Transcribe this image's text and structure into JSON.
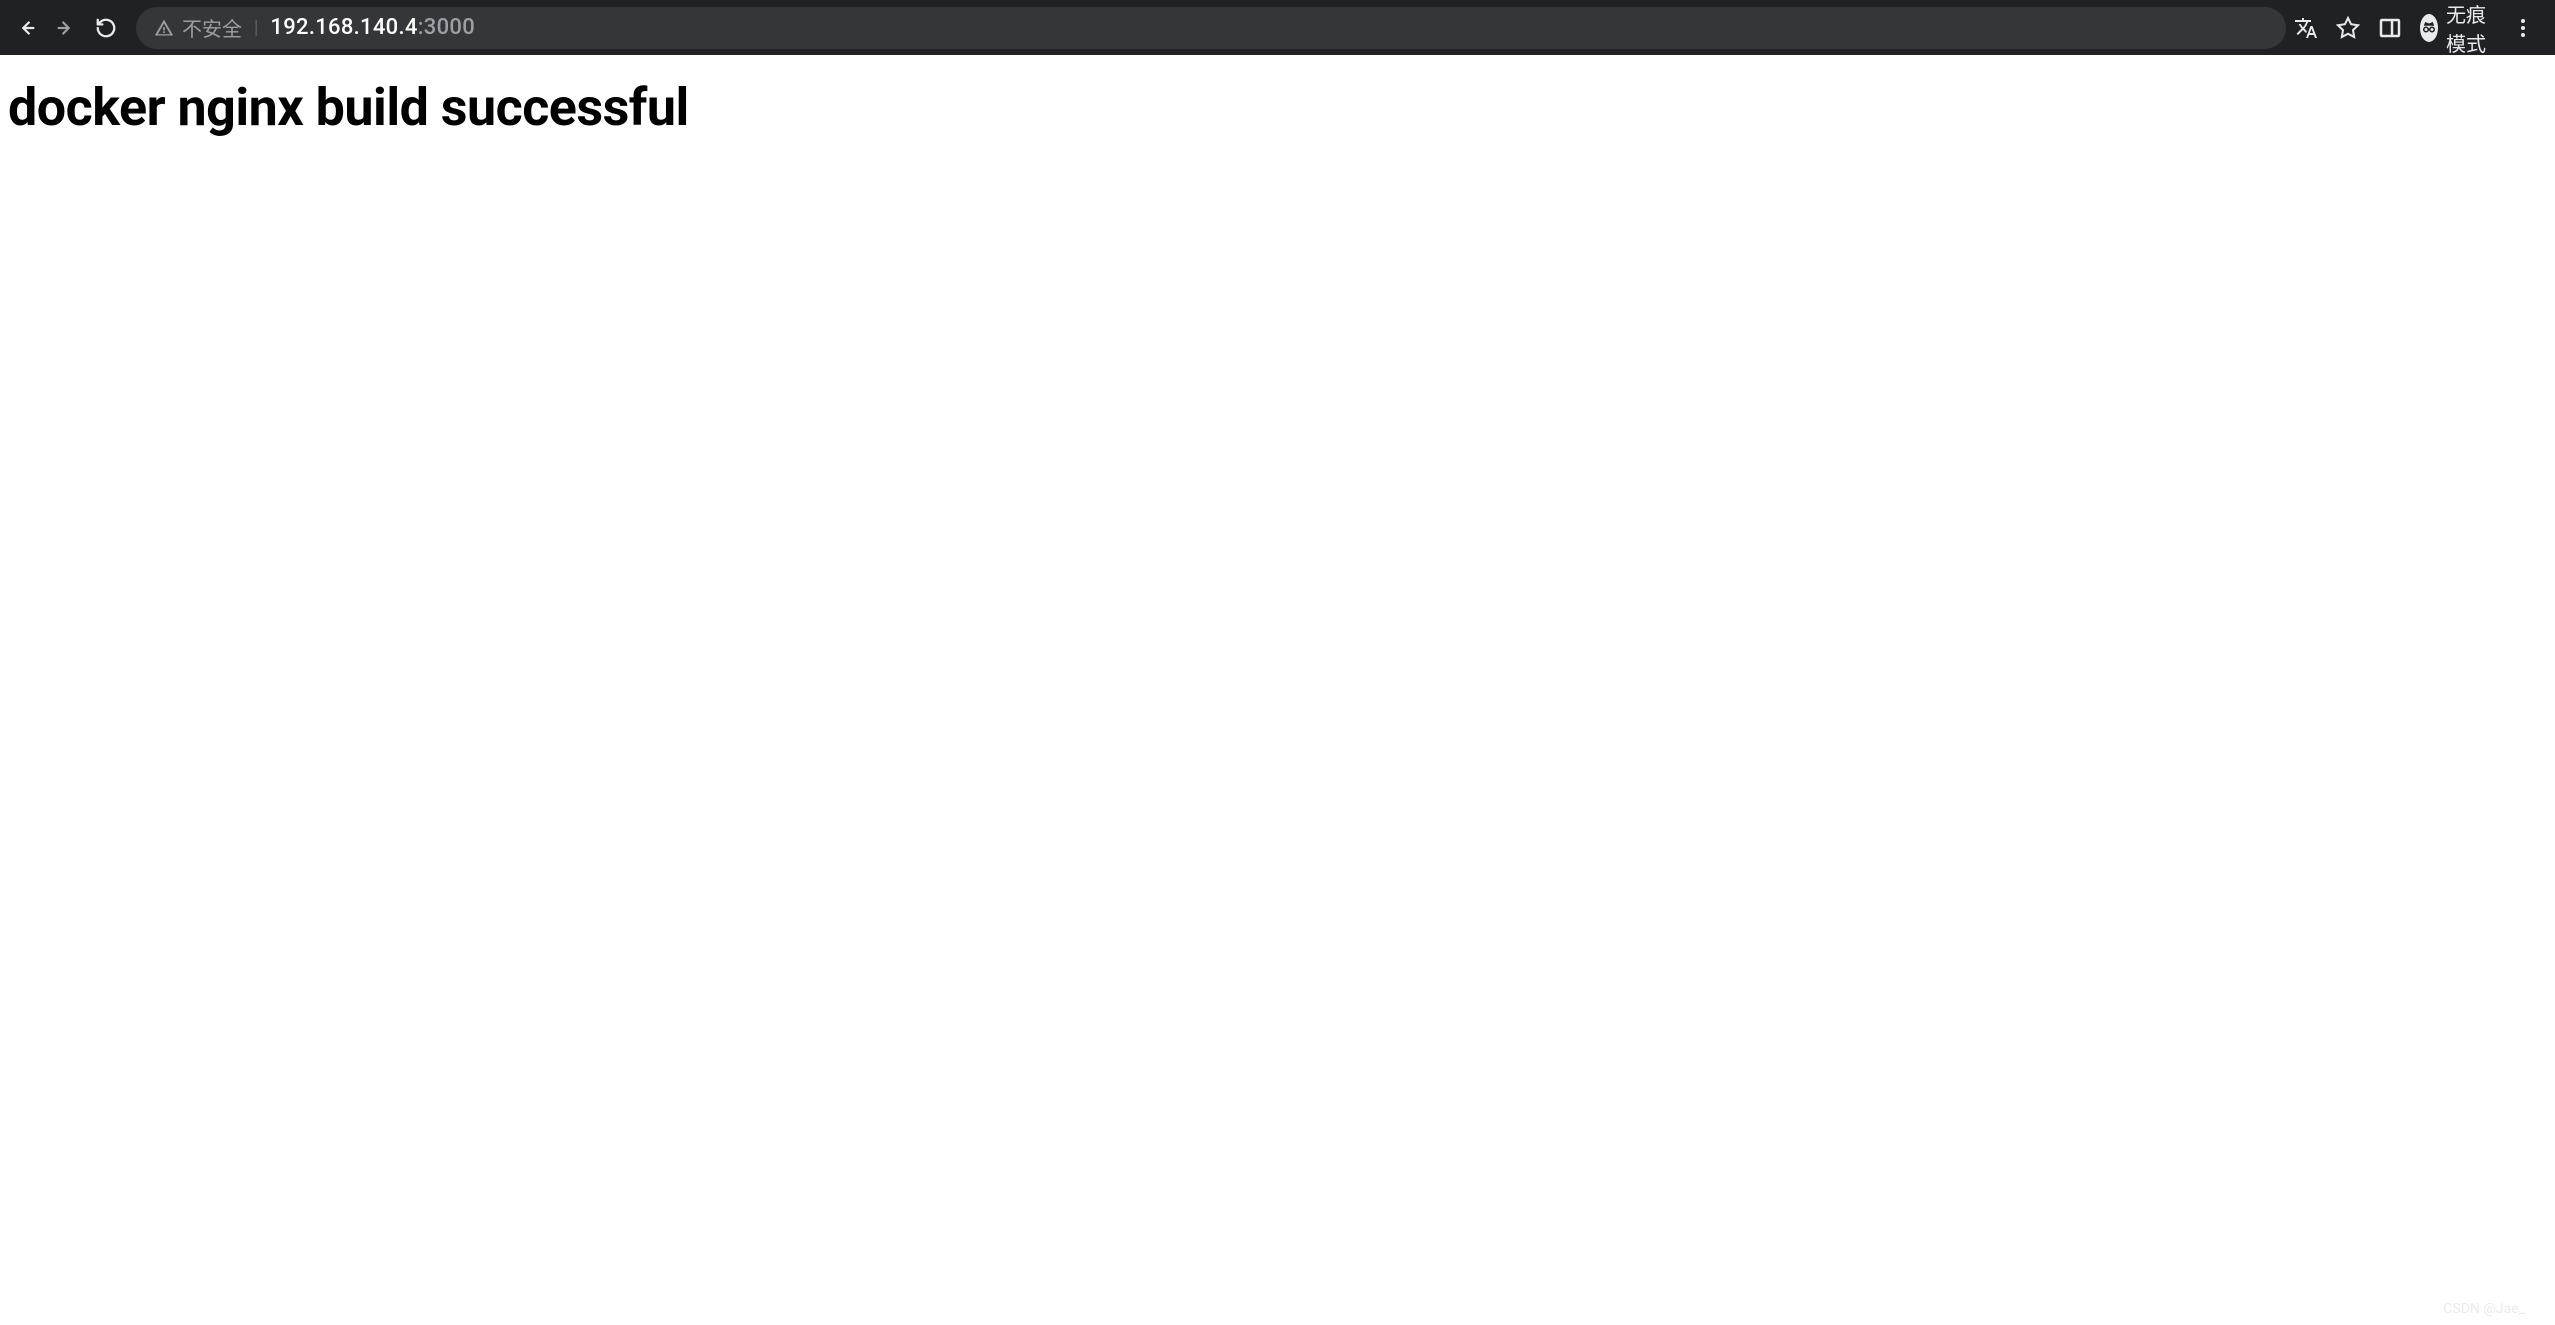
{
  "browser": {
    "security_label": "不安全",
    "url_host": "192.168.140.4",
    "url_port": ":3000",
    "profile_label": "无痕模式"
  },
  "page": {
    "heading": "docker nginx build successful"
  },
  "watermark": "CSDN @Jae_"
}
